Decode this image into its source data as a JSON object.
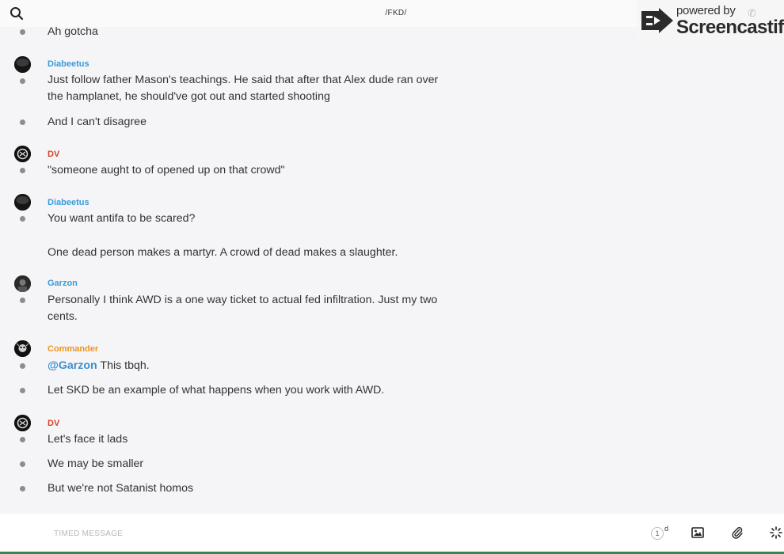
{
  "header": {
    "title": "/FKD/"
  },
  "watermark": {
    "powered_by": "powered by",
    "brand": "Screencastify"
  },
  "messages": {
    "m1": {
      "text": "Ah gotcha"
    },
    "g2": {
      "author": "Diabeetus",
      "lines": [
        "Just follow father Mason's teachings. He said that after that Alex dude ran over the hamplanet, he should've got out and started shooting",
        "And I can't disagree"
      ]
    },
    "g3": {
      "author": "DV",
      "lines": [
        "\"someone aught to of opened up on that crowd\""
      ]
    },
    "g4": {
      "author": "Diabeetus",
      "lines": [
        "You want antifa to be scared?",
        "One dead person makes a martyr. A crowd of dead makes a slaughter."
      ]
    },
    "g5": {
      "author": "Garzon",
      "lines": [
        "Personally I think AWD is a one way ticket to actual fed infiltration. Just my two cents."
      ]
    },
    "g6": {
      "author": "Commander",
      "mention": "@Garzon",
      "mention_rest": " This tbqh.",
      "lines": [
        "Let SKD be an example of what happens when you work with AWD."
      ]
    },
    "g7": {
      "author": "DV",
      "lines": [
        "Let's face it lads",
        "We may be smaller",
        "But we're not Satanist homos"
      ]
    }
  },
  "composer": {
    "placeholder": "TIMED MESSAGE",
    "timer_value": "1",
    "timer_unit": "d"
  },
  "colors": {
    "blue_author": "#3a9ad9",
    "red_author": "#d8402b",
    "orange_author": "#f0931b",
    "bullet": "#8d8d8d"
  }
}
